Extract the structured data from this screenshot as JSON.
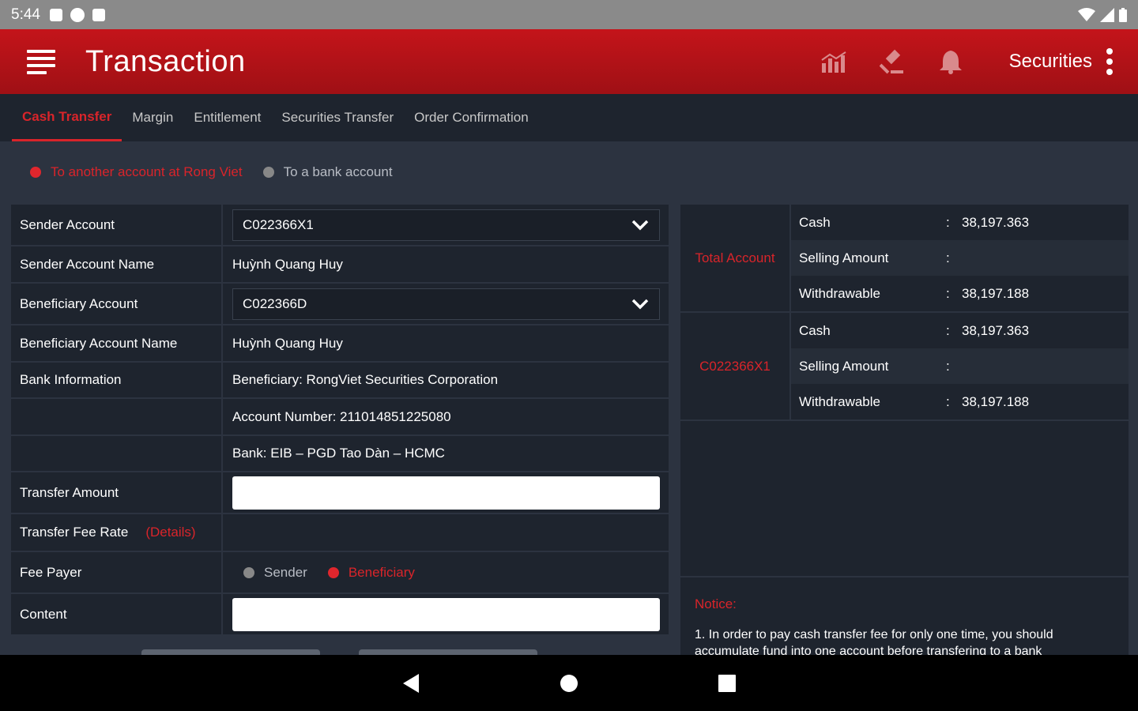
{
  "status_bar": {
    "time": "5:44"
  },
  "app_bar": {
    "title": "Transaction",
    "account_type": "Securities"
  },
  "tabs": [
    {
      "label": "Cash Transfer",
      "active": true
    },
    {
      "label": "Margin",
      "active": false
    },
    {
      "label": "Entitlement",
      "active": false
    },
    {
      "label": "Securities Transfer",
      "active": false
    },
    {
      "label": "Order Confirmation",
      "active": false
    }
  ],
  "transfer_type": {
    "option1": "To another account at Rong Viet",
    "option2": "To a bank account",
    "selected": "option1"
  },
  "form": {
    "sender_account_label": "Sender Account",
    "sender_account_value": "C022366X1",
    "sender_name_label": "Sender Account Name",
    "sender_name_value": "Huỳnh Quang Huy",
    "beneficiary_account_label": "Beneficiary Account",
    "beneficiary_account_value": "C022366D",
    "beneficiary_name_label": "Beneficiary Account Name",
    "beneficiary_name_value": "Huỳnh Quang Huy",
    "bank_info_label": "Bank Information",
    "bank_beneficiary": "Beneficiary:  RongViet Securities Corporation",
    "bank_account_number": "Account Number:  211014851225080",
    "bank_name": "Bank:  EIB – PGD Tao Dàn – HCMC",
    "transfer_amount_label": "Transfer Amount",
    "transfer_amount_value": "",
    "fee_rate_label": "Transfer Fee Rate",
    "fee_rate_details": "(Details)",
    "fee_payer_label": "Fee Payer",
    "fee_payer_sender": "Sender",
    "fee_payer_beneficiary": "Beneficiary",
    "fee_payer_selected": "Beneficiary",
    "content_label": "Content",
    "content_value": ""
  },
  "balances": {
    "total": {
      "name": "Total Account",
      "cash_label": "Cash",
      "cash_value": "38,197.363",
      "selling_label": "Selling Amount",
      "selling_value": "",
      "withdrawable_label": "Withdrawable",
      "withdrawable_value": "38,197.188"
    },
    "account": {
      "name": "C022366X1",
      "cash_label": "Cash",
      "cash_value": "38,197.363",
      "selling_label": "Selling Amount",
      "selling_value": "",
      "withdrawable_label": "Withdrawable",
      "withdrawable_value": "38,197.188"
    }
  },
  "notice": {
    "title": "Notice:",
    "text": "1. In order to pay cash transfer fee for only one time, you should accumulate fund into one account before transfering to a bank"
  },
  "colors": {
    "accent": "#d9242a",
    "app_bar": "#c4141a",
    "background": "#2c3340",
    "panel": "#1e242e"
  },
  "icons": [
    "menu-icon",
    "chart-icon",
    "gavel-icon",
    "bell-icon",
    "more-vert-icon",
    "chevron-down-icon",
    "back-icon",
    "home-icon",
    "recents-icon"
  ]
}
